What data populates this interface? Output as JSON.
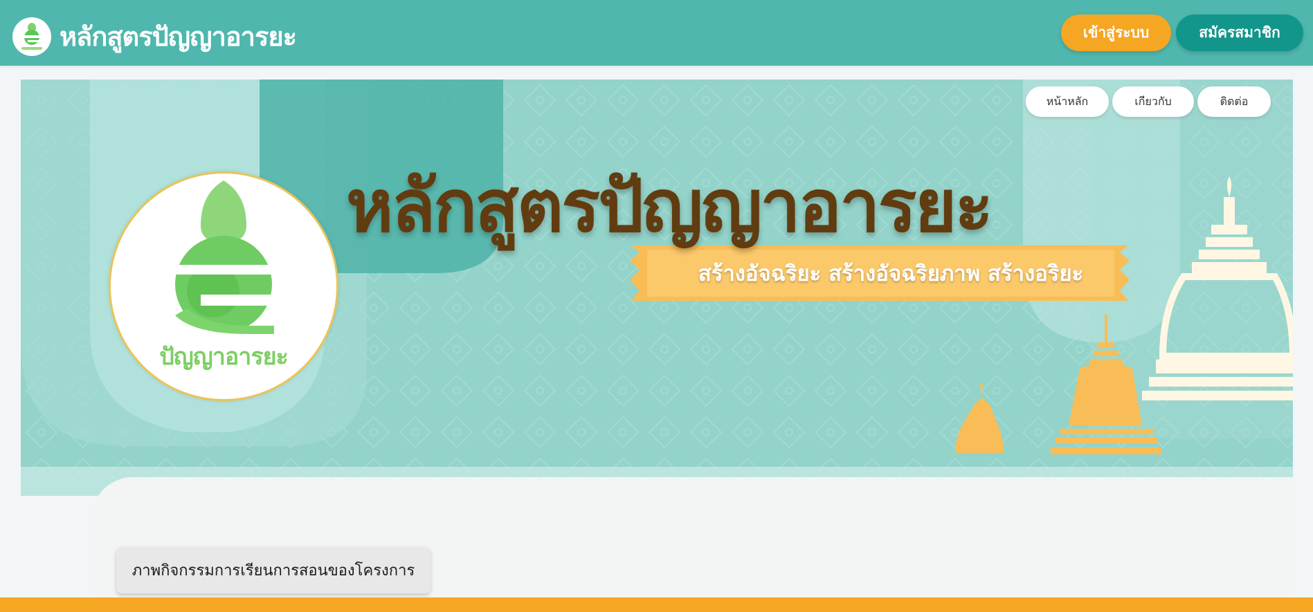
{
  "header": {
    "brand_name": "หลักสูตรปัญญาอารยะ",
    "login_label": "เข้าสู่ระบบ",
    "register_label": "สมัครสมาชิก"
  },
  "banner": {
    "nav": {
      "home": "หน้าหลัก",
      "about": "เกียวกับ",
      "contact": "ติดต่อ"
    },
    "title": "หลักสูตรปัญญาอารยะ",
    "subtitle": "สร้างอัจฉริยะ สร้างอัจฉริยภาพ สร้างอริยะ",
    "logo_text": "ปัญญาอารยะ"
  },
  "content": {
    "activity_tab_label": "ภาพกิจกรรมการเรียนการสอนของโครงการ"
  },
  "colors": {
    "header_bg": "#4fb7ad",
    "login_button": "#f5a623",
    "register_button": "#12968b",
    "title_text": "#613c10",
    "ribbon": "#f8bd57",
    "bottom_bar": "#f5a623"
  },
  "icons": {
    "brand_logo": "panyaarya-logo-icon",
    "pagoda": "pagoda-icon"
  }
}
